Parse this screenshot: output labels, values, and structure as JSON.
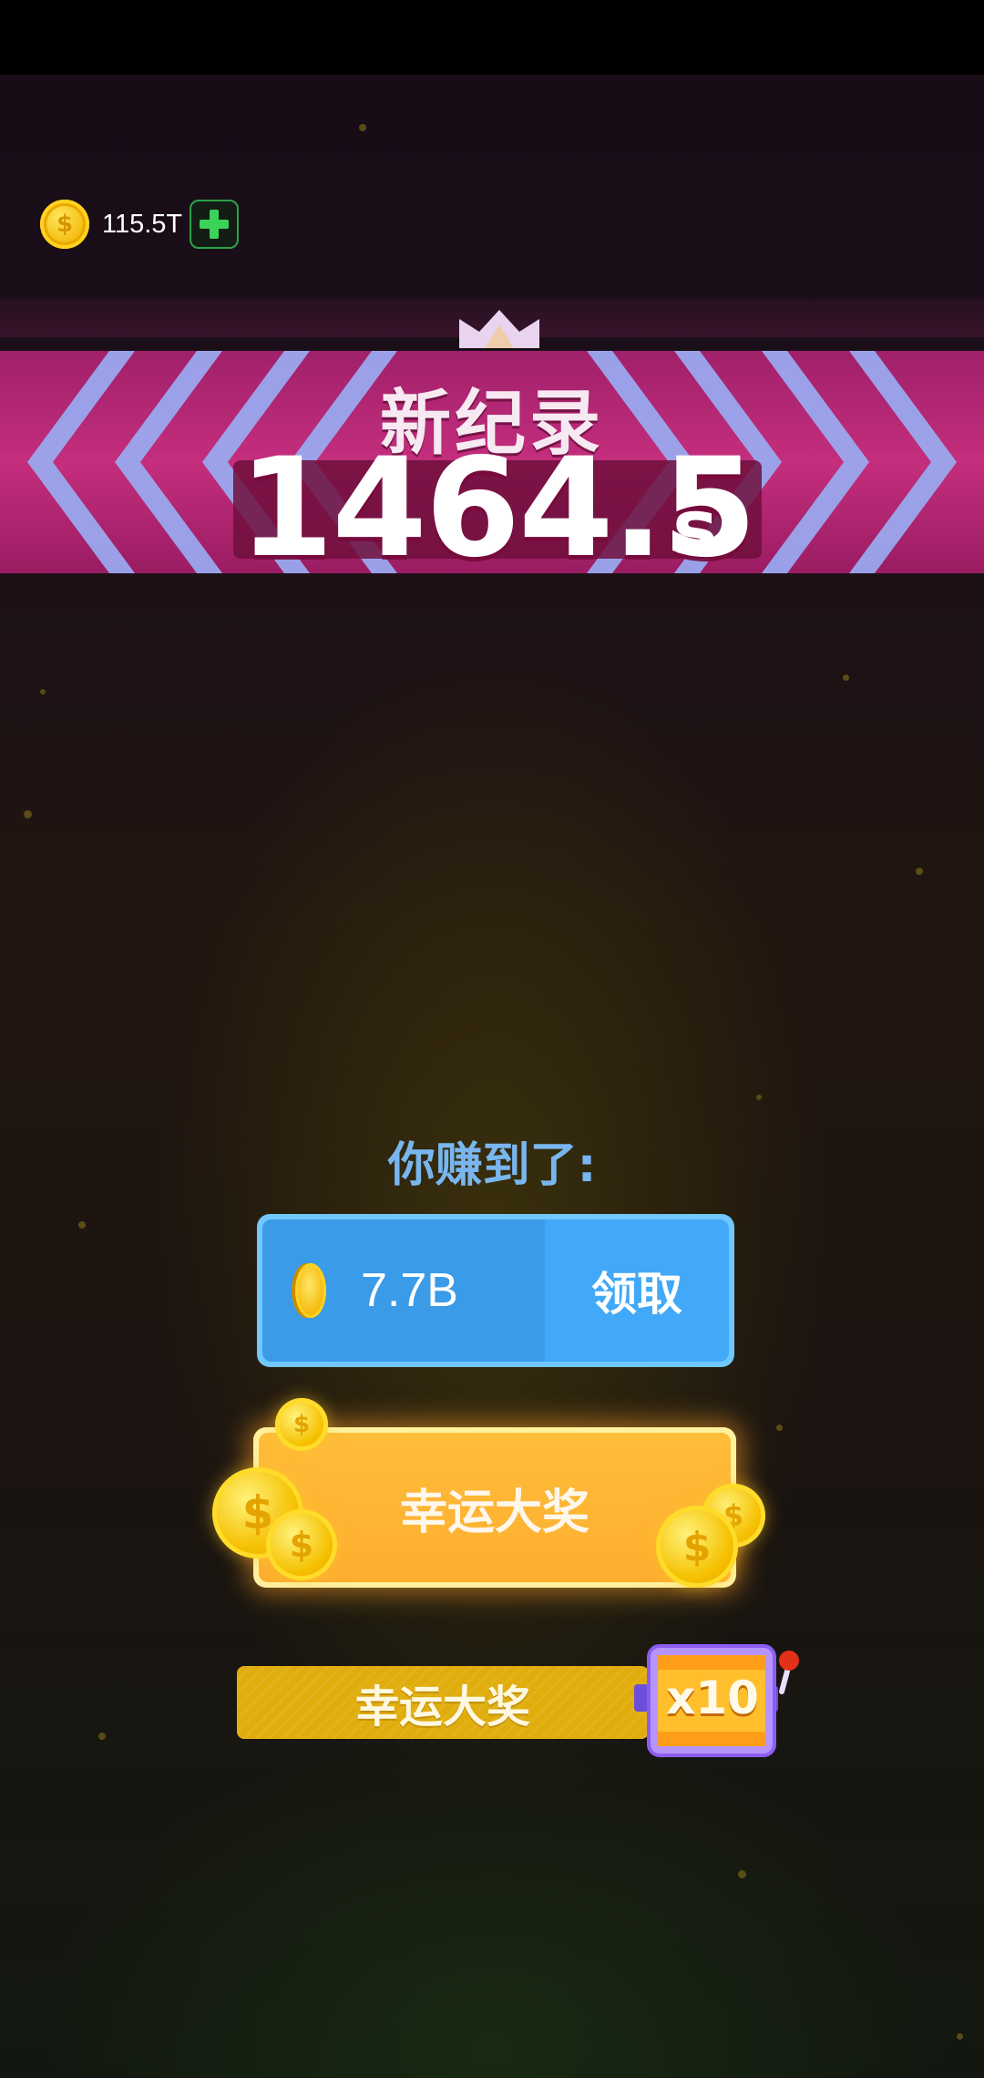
{
  "header": {
    "coin_balance": "115.5T",
    "add_icon": "plus-icon",
    "coin_icon": "dollar-coin-icon"
  },
  "record": {
    "title": "新纪录",
    "time_value": "1464.5",
    "time_unit": "s",
    "crown_icon": "crown-icon"
  },
  "reward": {
    "earned_label": "你赚到了:",
    "amount": "7.7B",
    "claim_label": "领取"
  },
  "jackpot": {
    "main_label": "幸运大奖",
    "secondary_label": "幸运大奖",
    "multiplier": "x10",
    "slot_icon": "slot-machine-icon"
  },
  "colors": {
    "banner_pink": "#8a1a55",
    "chevron_blue": "#9aa8ee",
    "claim_blue": "#41a9f7",
    "jackpot_orange": "#fdae2f",
    "gold": "#e0ad0d",
    "label_blue": "#79b6f0"
  }
}
